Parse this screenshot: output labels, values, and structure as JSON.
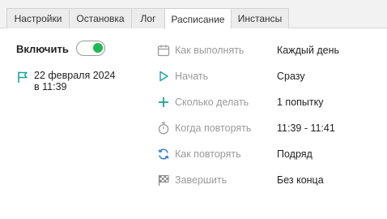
{
  "tabs": [
    {
      "label": "Настройки",
      "active": false
    },
    {
      "label": "Остановка",
      "active": false
    },
    {
      "label": "Лог",
      "active": false
    },
    {
      "label": "Расписание",
      "active": true
    },
    {
      "label": "Инстансы",
      "active": false
    }
  ],
  "enable": {
    "label": "Включить",
    "on": true
  },
  "start_info": {
    "line1": "22 февраля 2024",
    "line2": "в 11:39"
  },
  "schedule": [
    {
      "icon": "calendar-icon",
      "key": "Как выполнять",
      "value": "Каждый день"
    },
    {
      "icon": "play-icon",
      "key": "Начать",
      "value": "Сразу"
    },
    {
      "icon": "plus-icon",
      "key": "Сколько делать",
      "value": "1 попытку"
    },
    {
      "icon": "stopwatch-icon",
      "key": "Когда повторять",
      "value": "11:39 - 11:41"
    },
    {
      "icon": "repeat-icon",
      "key": "Как повторять",
      "value": "Подряд"
    },
    {
      "icon": "checkered-flag-icon",
      "key": "Завершить",
      "value": "Без конца"
    }
  ],
  "colors": {
    "accent_green": "#1db954",
    "teal": "#1aa59a",
    "blue": "#2e7fd6",
    "muted": "#9a9a9a"
  }
}
